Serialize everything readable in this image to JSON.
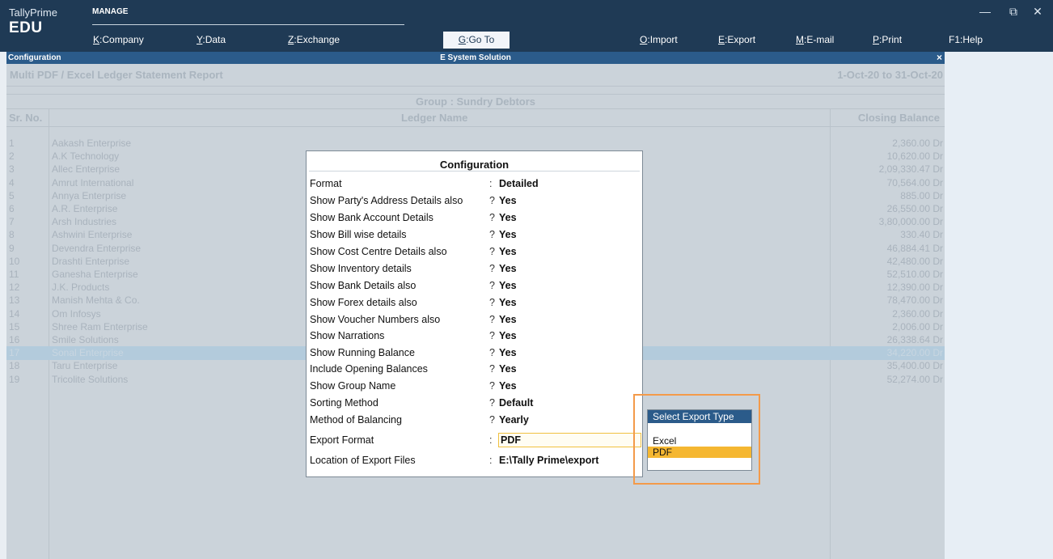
{
  "app": {
    "name": "TallyPrime",
    "edition": "EDU",
    "section": "MANAGE"
  },
  "menu": [
    {
      "key": "K",
      "label": "Company"
    },
    {
      "key": "Y",
      "label": "Data"
    },
    {
      "key": "Z",
      "label": "Exchange"
    },
    {
      "key": "G",
      "label": "Go To"
    },
    {
      "key": "O",
      "label": "Import"
    },
    {
      "key": "E",
      "label": "Export"
    },
    {
      "key": "M",
      "label": "E-mail"
    },
    {
      "key": "P",
      "label": "Print"
    },
    {
      "key": "F1",
      "label": "Help"
    }
  ],
  "window_controls": {
    "minimize": "—",
    "restore": "⧉",
    "close": "✕"
  },
  "titlebar": {
    "left": "Configuration",
    "center": "E System Solution",
    "close": "×"
  },
  "report": {
    "title": "Multi PDF / Excel Ledger Statement Report",
    "period": "1-Oct-20 to 31-Oct-20",
    "group": "Group : Sundry Debtors",
    "columns": {
      "sr": "Sr. No.",
      "name": "Ledger Name",
      "balance": "Closing Balance"
    },
    "rows": [
      {
        "sr": "1",
        "name": "Aakash Enterprise",
        "balance": "2,360.00 Dr"
      },
      {
        "sr": "2",
        "name": "A.K Technology",
        "balance": "10,620.00 Dr"
      },
      {
        "sr": "3",
        "name": "Allec Enterprise",
        "balance": "2,09,330.47 Dr"
      },
      {
        "sr": "4",
        "name": "Amrut International",
        "balance": "70,564.00 Dr"
      },
      {
        "sr": "5",
        "name": "Annya Enterprise",
        "balance": "885.00 Dr"
      },
      {
        "sr": "6",
        "name": "A.R. Enterprise",
        "balance": "26,550.00 Dr"
      },
      {
        "sr": "7",
        "name": "Arsh Industries",
        "balance": "3,80,000.00 Dr"
      },
      {
        "sr": "8",
        "name": "Ashwini Enterprise",
        "balance": "330.40 Dr"
      },
      {
        "sr": "9",
        "name": "Devendra Enterprise",
        "balance": "46,884.41 Dr"
      },
      {
        "sr": "10",
        "name": "Drashti Enterprise",
        "balance": "42,480.00 Dr"
      },
      {
        "sr": "11",
        "name": "Ganesha Enterprise",
        "balance": "52,510.00 Dr"
      },
      {
        "sr": "12",
        "name": "J.K. Products",
        "balance": "12,390.00 Dr"
      },
      {
        "sr": "13",
        "name": "Manish Mehta & Co.",
        "balance": "78,470.00 Dr"
      },
      {
        "sr": "14",
        "name": "Om Infosys",
        "balance": "2,360.00 Dr"
      },
      {
        "sr": "15",
        "name": "Shree Ram Enterprise",
        "balance": "2,006.00 Dr"
      },
      {
        "sr": "16",
        "name": "Smile Solutions",
        "balance": "26,338.64 Dr"
      },
      {
        "sr": "17",
        "name": "Sonal Enterprise",
        "balance": "34,220.00 Dr"
      },
      {
        "sr": "18",
        "name": "Taru Enterprise",
        "balance": "35,400.00 Dr"
      },
      {
        "sr": "19",
        "name": "Tricolite Solutions",
        "balance": "52,274.00 Dr"
      }
    ]
  },
  "config": {
    "title": "Configuration",
    "rows": [
      {
        "label": "Format",
        "sep": ":",
        "value": "Detailed"
      },
      {
        "label": "Show Party's Address Details also",
        "sep": "?",
        "value": "Yes"
      },
      {
        "label": "Show Bank Account Details",
        "sep": "?",
        "value": "Yes"
      },
      {
        "label": "Show Bill wise details",
        "sep": "?",
        "value": "Yes"
      },
      {
        "label": "Show Cost Centre Details also",
        "sep": "?",
        "value": "Yes"
      },
      {
        "label": "Show Inventory details",
        "sep": "?",
        "value": "Yes"
      },
      {
        "label": "Show Bank Details also",
        "sep": "?",
        "value": "Yes"
      },
      {
        "label": "Show Forex details also",
        "sep": "?",
        "value": "Yes"
      },
      {
        "label": "Show Voucher Numbers also",
        "sep": "?",
        "value": "Yes"
      },
      {
        "label": "Show Narrations",
        "sep": "?",
        "value": "Yes"
      },
      {
        "label": "Show Running Balance",
        "sep": "?",
        "value": "Yes"
      },
      {
        "label": "Include Opening Balances",
        "sep": "?",
        "value": "Yes"
      },
      {
        "label": "Show Group Name",
        "sep": "?",
        "value": "Yes"
      },
      {
        "label": "Sorting Method",
        "sep": "?",
        "value": "Default"
      },
      {
        "label": "Method of Balancing",
        "sep": "?",
        "value": "Yearly"
      },
      {
        "label": "Export Format",
        "sep": ":",
        "value": "PDF"
      },
      {
        "label": "Location of Export Files",
        "sep": ":",
        "value": "E:\\Tally Prime\\export"
      }
    ]
  },
  "export_popup": {
    "title": "Select Export Type",
    "options": [
      "Excel",
      "PDF"
    ],
    "selected": "PDF"
  },
  "colors": {
    "topbar": "#1f3a55",
    "titlebar": "#2b5b8a",
    "selection": "#f5b731",
    "highlight_border": "#f39a4a"
  }
}
